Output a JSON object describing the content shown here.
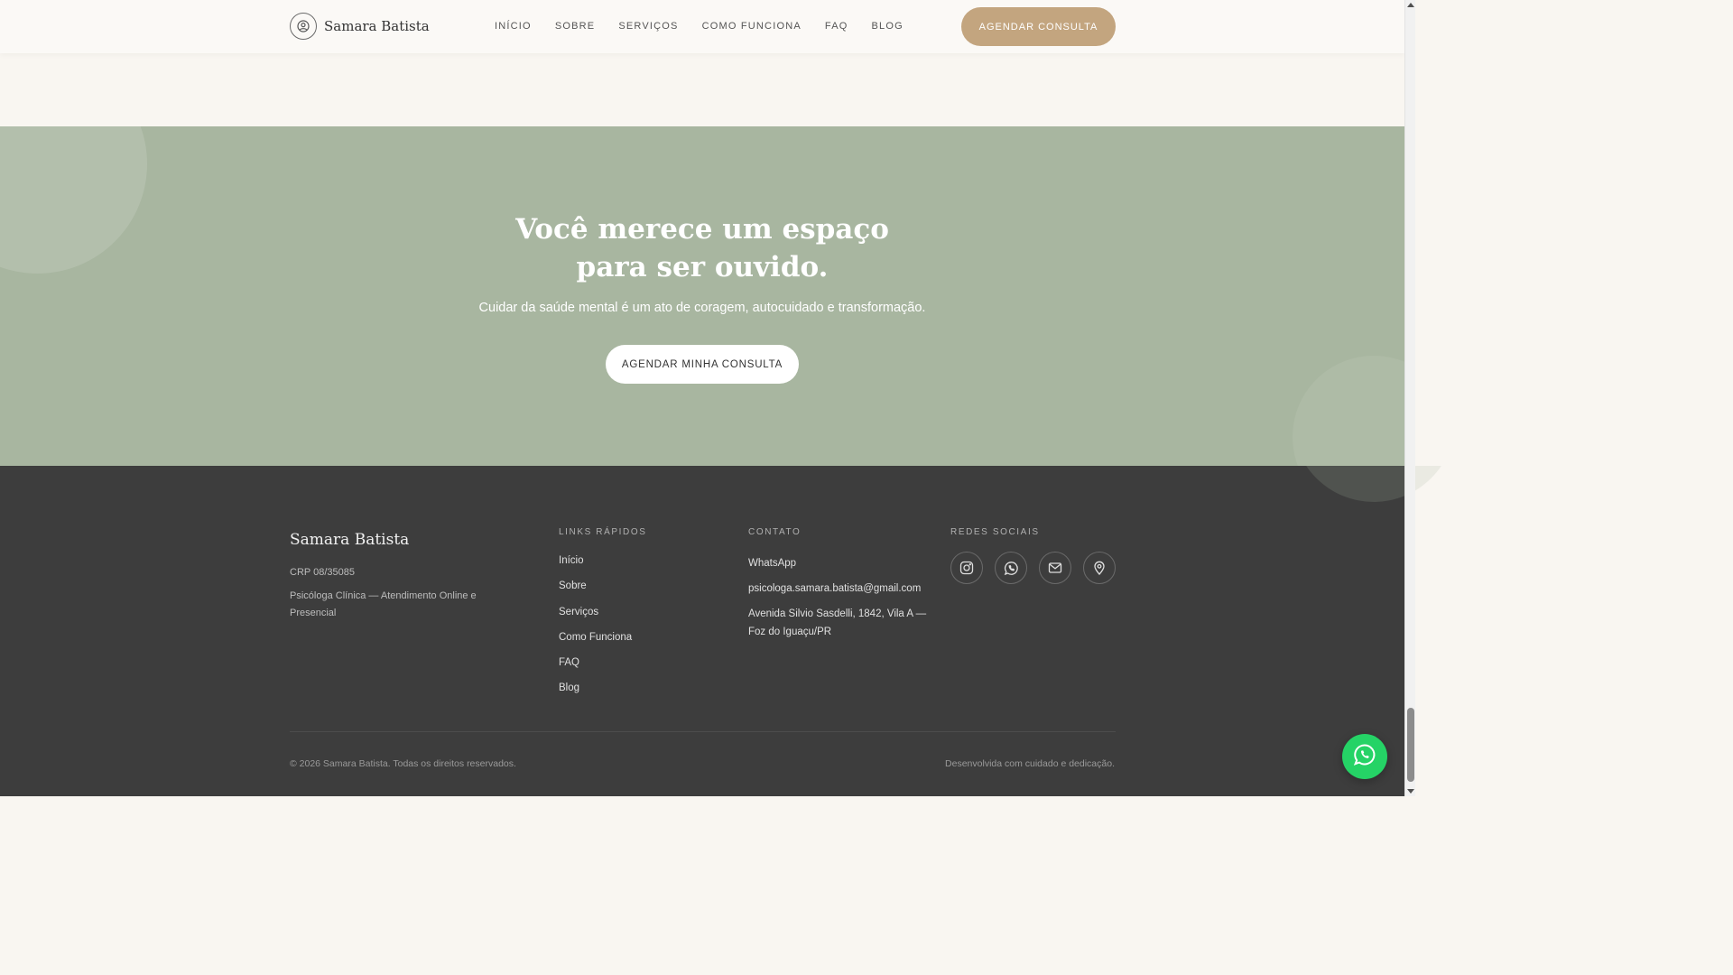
{
  "header": {
    "brand": "Samara Batista",
    "nav": [
      "INÍCIO",
      "SOBRE",
      "SERVIÇOS",
      "COMO FUNCIONA",
      "FAQ",
      "BLOG"
    ],
    "cta_label": "AGENDAR CONSULTA"
  },
  "cta_section": {
    "title": "Você merece um espaço para ser ouvido.",
    "subtitle": "Cuidar da saúde mental é um ato de coragem, autocuidado e transformação.",
    "button_label": "AGENDAR MINHA CONSULTA"
  },
  "footer": {
    "brand": "Samara Batista",
    "crp": "CRP 08/35085",
    "description": "Psicóloga Clínica — Atendimento Online e Presencial",
    "links_heading": "LINKS RÁPIDOS",
    "links": [
      "Início",
      "Sobre",
      "Serviços",
      "Como Funciona",
      "FAQ",
      "Blog"
    ],
    "contact_heading": "CONTATO",
    "contact": {
      "whatsapp": "WhatsApp",
      "email": "psicologa.samara.batista@gmail.com",
      "address": "Avenida Silvio Sasdelli, 1842, Vila A — Foz do Iguaçu/PR"
    },
    "social_heading": "REDES SOCIAIS",
    "social_icons": [
      "instagram-icon",
      "whatsapp-icon",
      "mail-icon",
      "map-pin-icon"
    ],
    "copyright": "© 2026 Samara Batista. Todas os direitos reservados.",
    "credit": "Desenvolvida com cuidado e dedicação."
  },
  "colors": {
    "accent": "#c3a57f",
    "sage": "#a8b6a0",
    "footer_bg": "#3d3d3d",
    "whatsapp": "#25d366"
  }
}
